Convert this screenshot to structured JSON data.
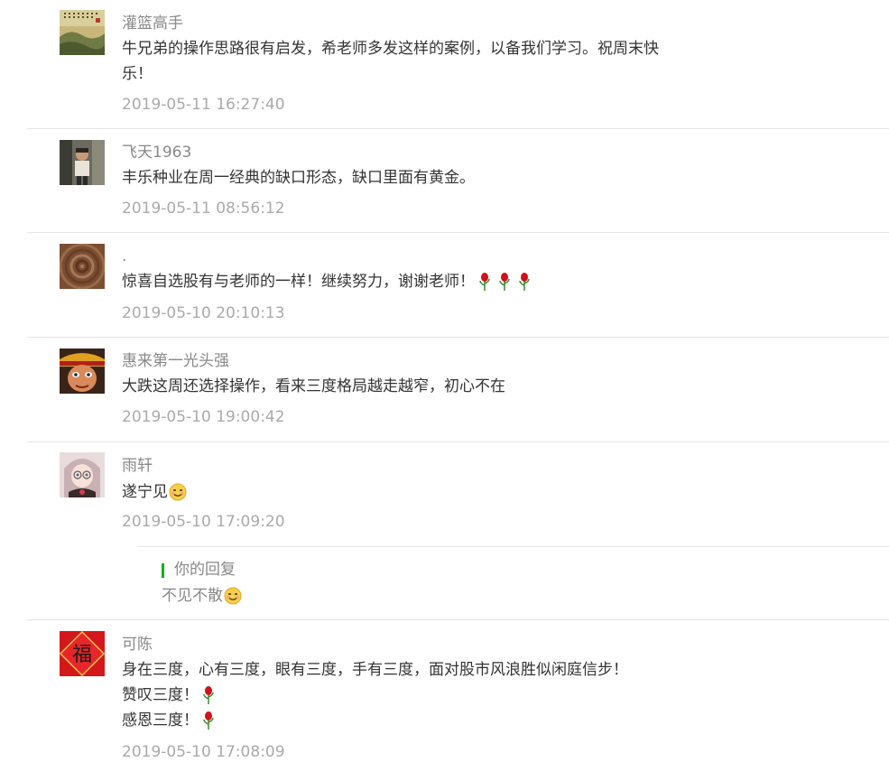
{
  "comments": [
    {
      "nickname": "灌篮高手",
      "lines": [
        "牛兄弟的操作思路很有启发，希老师多发这样的案例，以备我们学习。祝周末快",
        "乐！"
      ],
      "time": "2019-05-11 16:27:40",
      "avatar": "landscape-painting-avatar"
    },
    {
      "nickname": "飞天1963",
      "lines": [
        "丰乐种业在周一经典的缺口形态，缺口里面有黄金。"
      ],
      "time": "2019-05-11 08:56:12",
      "avatar": "child-photo-avatar"
    },
    {
      "nickname": ".",
      "lines": [
        "惊喜自选股有与老师的一样！继续努力，谢谢老师！"
      ],
      "rose_count": 3,
      "time": "2019-05-10 20:10:13",
      "avatar": "wood-rings-avatar"
    },
    {
      "nickname": "惠来第一光头强",
      "lines": [
        "大跌这周还选择操作，看来三度格局越走越窄，初心不在"
      ],
      "time": "2019-05-10 19:00:42",
      "avatar": "monkey-king-avatar"
    },
    {
      "nickname": "雨轩",
      "lines": [
        "遂宁见"
      ],
      "time": "2019-05-10 17:09:20",
      "avatar": "anime-girl-avatar",
      "reply": {
        "title": "你的回复",
        "text": "不见不散"
      }
    },
    {
      "nickname": "可陈",
      "lines": [
        "身在三度，心有三度，眼有三度，手有三度，面对股市风浪胜似闲庭信步！",
        "赞叹三度！",
        "感恩三度！"
      ],
      "time": "2019-05-10 17:08:09",
      "avatar": "fu-character-avatar",
      "fu_char": "福"
    }
  ],
  "colors": {
    "accent": "#1aad19",
    "nickname": "#888888",
    "content": "#333333",
    "time": "#aaaaaa",
    "rose": "#d0121b",
    "leaf": "#3a8a2a"
  }
}
